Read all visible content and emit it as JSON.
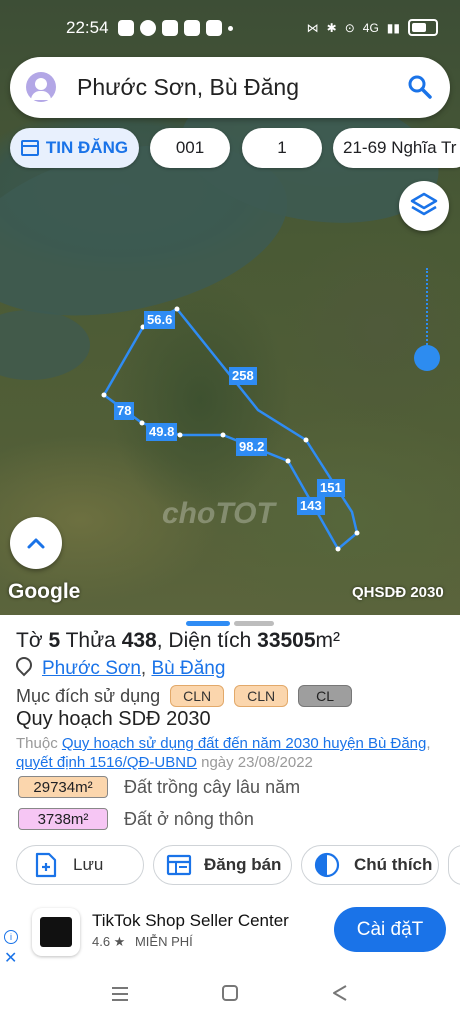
{
  "status_bar": {
    "time": "22:54",
    "network": "4G"
  },
  "search": {
    "query": "Phước Sơn, Bù Đăng"
  },
  "chips": [
    {
      "label": "TIN ĐĂNG"
    },
    {
      "label": "001"
    },
    {
      "label": "1"
    },
    {
      "label": "21-69 Nghĩa Tr"
    }
  ],
  "map": {
    "google_label": "Google",
    "plan_label": "QHSDĐ 2030",
    "watermark": "choTOT",
    "edges": [
      {
        "label": "56.6"
      },
      {
        "label": "258"
      },
      {
        "label": "78"
      },
      {
        "label": "49.8"
      },
      {
        "label": "98.2"
      },
      {
        "label": "151"
      },
      {
        "label": "143"
      }
    ],
    "parcel_color": "#2f8cf4"
  },
  "sheet": {
    "to_label": "Tờ",
    "to_value": "5",
    "thua_label": "Thửa",
    "thua_value": "438",
    "area_label": ", Diện tích",
    "area_value": "33505",
    "area_unit": "m²",
    "location_parts": [
      "Phước Sơn",
      "Bù Đăng"
    ],
    "location_sep": ", ",
    "purpose_label": "Mục đích sử dụng",
    "purpose_tags": [
      "CLN",
      "CLN",
      "CL"
    ],
    "plan_title": "Quy hoạch SDĐ 2030",
    "belongs_prefix": "Thuộc",
    "belongs_link1": "Quy hoạch sử dụng đất đến năm 2030 huyện Bù Đăng",
    "belongs_sep": ", ",
    "belongs_link2": "quyết định 1516/QĐ-UBND",
    "belongs_date": "ngày 23/08/2022",
    "areas": [
      {
        "value": "29734m²",
        "desc": "Đất trồng cây lâu năm",
        "color": "#fbd6ad"
      },
      {
        "value": "3738m²",
        "desc": "Đất ở nông thôn",
        "color": "#f6c6f4"
      }
    ],
    "actions": [
      {
        "label": "Lưu",
        "icon": "add-document-icon"
      },
      {
        "label": "Đăng bán",
        "icon": "listing-icon"
      },
      {
        "label": "Chú thích",
        "icon": "legend-icon"
      }
    ]
  },
  "ad": {
    "name": "TikTok Shop Seller Center",
    "rating": "4.6 ★",
    "price": "MIỄN PHÍ",
    "install": "Cài đặT"
  },
  "colors": {
    "accent": "#1a73e8",
    "cln": "#fbd6ad",
    "cl": "#9e9e9e"
  }
}
